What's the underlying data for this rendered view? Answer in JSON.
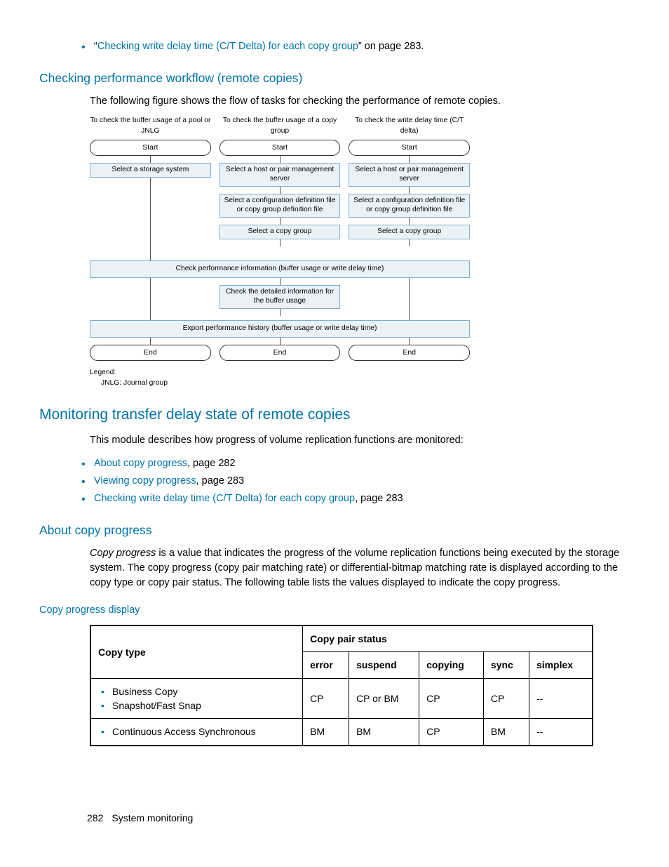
{
  "top_bullet": {
    "quote_open": "“",
    "link": "Checking write delay time (C/T Delta) for each copy group",
    "quote_close": "” on page 283."
  },
  "section1": {
    "heading": "Checking performance workflow (remote copies)",
    "para": "The following figure shows the flow of tasks for checking the performance of remote copies."
  },
  "flow": {
    "col1_head": "To check the buffer usage of a pool or JNLG",
    "col2_head": "To check the buffer usage of a copy group",
    "col3_head": "To check the write delay time (C/T delta)",
    "start": "Start",
    "c1_b1": "Select a storage system",
    "c2_b1": "Select a host or pair management server",
    "c3_b1": "Select a host or pair management server",
    "c2_b2": "Select a configuration definition file or copy group definition file",
    "c3_b2": "Select a configuration definition file or copy group definition file",
    "c2_b3": "Select a copy group",
    "c3_b3": "Select a copy group",
    "wide1": "Check performance information (buffer usage or write delay time)",
    "mid_detail": "Check the detailed information for the buffer usage",
    "wide2": "Export performance history (buffer usage or write delay time)",
    "end": "End",
    "legend_title": "Legend:",
    "legend_item": "JNLG: Journal group"
  },
  "section2": {
    "heading": "Monitoring transfer delay state of remote copies",
    "intro": "This module describes how progress of volume replication functions are monitored:",
    "items": [
      {
        "link": "About copy progress",
        "suffix": ", page 282"
      },
      {
        "link": "Viewing copy progress",
        "suffix": ", page 283"
      },
      {
        "link": "Checking write delay time (C/T Delta) for each copy group",
        "suffix": ", page 283"
      }
    ]
  },
  "section3": {
    "heading": "About copy progress",
    "para_prefix_italic": "Copy progress",
    "para_rest": " is a value that indicates the progress of the volume replication functions being executed by the storage system. The copy progress (copy pair matching rate) or differential-bitmap matching rate is displayed according to the copy type or copy pair status. The following table lists the values displayed to indicate the copy progress."
  },
  "table": {
    "caption": "Copy progress display",
    "h_copytype": "Copy type",
    "h_status": "Copy pair status",
    "h_error": "error",
    "h_suspend": "suspend",
    "h_copying": "copying",
    "h_sync": "sync",
    "h_simplex": "simplex",
    "rows": [
      {
        "types": [
          "Business Copy",
          "Snapshot/Fast Snap"
        ],
        "error": "CP",
        "suspend": "CP or BM",
        "copying": "CP",
        "sync": "CP",
        "simplex": "--"
      },
      {
        "types": [
          "Continuous Access Synchronous"
        ],
        "error": "BM",
        "suspend": "BM",
        "copying": "CP",
        "sync": "BM",
        "simplex": "--"
      }
    ]
  },
  "footer": {
    "page": "282",
    "title": "System monitoring"
  }
}
